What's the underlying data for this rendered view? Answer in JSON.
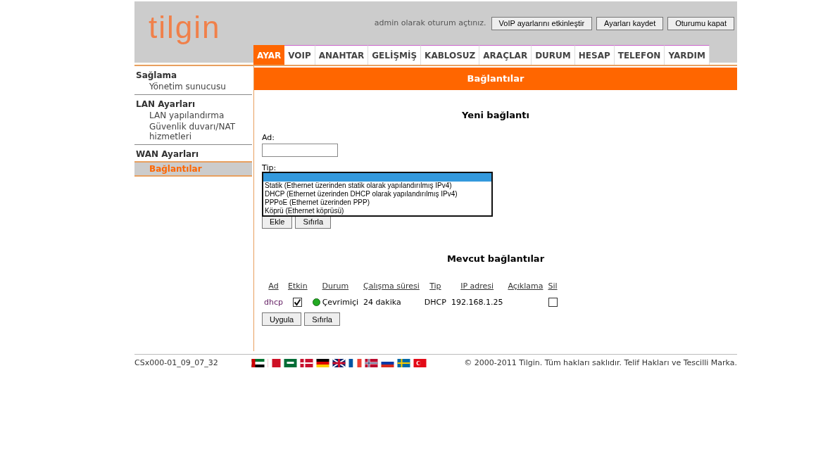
{
  "header": {
    "login_text": "admin olarak oturum açtınız.",
    "buttons": [
      "VoIP ayarlarını etkinleştir",
      "Ayarları kaydet",
      "Oturumu kapat"
    ]
  },
  "logo": "tilgin",
  "tabs": [
    {
      "label": "AYAR",
      "selected": true
    },
    {
      "label": "VOIP",
      "selected": false
    },
    {
      "label": "ANAHTAR",
      "selected": false
    },
    {
      "label": "GELİŞMİŞ",
      "selected": false
    },
    {
      "label": "KABLOSUZ",
      "selected": false
    },
    {
      "label": "ARAÇLAR",
      "selected": false
    },
    {
      "label": "DURUM",
      "selected": false
    },
    {
      "label": "HESAP",
      "selected": false
    },
    {
      "label": "TELEFON",
      "selected": false
    },
    {
      "label": "YARDIM",
      "selected": false
    }
  ],
  "sidebar": [
    {
      "heading": "Sağlama",
      "items": [
        {
          "label": "Yönetim sunucusu",
          "selected": false
        }
      ]
    },
    {
      "heading": "LAN Ayarları",
      "items": [
        {
          "label": "LAN yapılandırma",
          "selected": false
        },
        {
          "label": "Güvenlik duvarı/NAT hizmetleri",
          "selected": false
        }
      ]
    },
    {
      "heading": "WAN Ayarları",
      "items": [
        {
          "label": "Bağlantılar",
          "selected": true
        }
      ]
    }
  ],
  "page_title": "Bağlantılar",
  "new_connection": {
    "heading": "Yeni bağlantı",
    "name_label": "Ad:",
    "type_label": "Tip:",
    "type_options": [
      {
        "selected": true
      },
      {
        "label": "Statik (Ethernet üzerinden statik olarak yapılandırılmış IPv4)",
        "selected": false
      },
      {
        "label": "DHCP (Ethernet üzerinden DHCP olarak yapılandırılmış IPv4)",
        "selected": false
      },
      {
        "label": "PPPoE (Ethernet üzerinden PPP)",
        "selected": false
      },
      {
        "label": "Köprü (Ethernet köprüsü)",
        "selected": false
      }
    ],
    "buttons": [
      "Ekle",
      "Sıfırla"
    ]
  },
  "existing": {
    "heading": "Mevcut bağlantılar",
    "columns": [
      "Ad",
      "Etkin",
      "Durum",
      "Çalışma süresi",
      "Tip",
      "IP adresi",
      "Açıklama",
      "Sil"
    ],
    "rows": [
      {
        "name": "dhcp",
        "enabled": true,
        "color": "#22aa22",
        "status": "Çevrimiçi",
        "uptime": "24 dakika",
        "type": "DHCP",
        "ip": "192.168.1.25",
        "delete": false
      }
    ],
    "buttons": [
      "Uygula",
      "Sıfırla"
    ]
  },
  "footer": {
    "version": "CSx000-01_09_07_32",
    "copyright": "© 2000-2011 Tilgin. Tüm hakları saklıdır. Telif Hakları ve Tescilli Marka."
  }
}
